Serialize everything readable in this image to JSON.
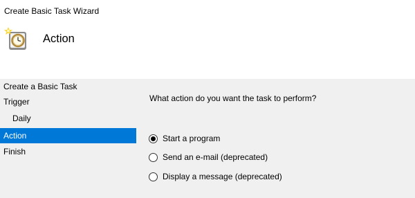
{
  "window": {
    "title": "Create Basic Task Wizard",
    "icon": "task-scheduler-clock-icon"
  },
  "header": {
    "title": "Action"
  },
  "steps": [
    {
      "label": "Create a Basic Task",
      "active": false
    },
    {
      "label": "Trigger",
      "active": false
    },
    {
      "label": "Daily",
      "active": false,
      "sub": true
    },
    {
      "label": "Action",
      "active": true
    },
    {
      "label": "Finish",
      "active": false
    }
  ],
  "content": {
    "question": "What action do you want the task to perform?",
    "options": [
      {
        "label": "Start a program",
        "checked": true
      },
      {
        "label": "Send an e-mail (deprecated)",
        "checked": false
      },
      {
        "label": "Display a message (deprecated)",
        "checked": false
      }
    ]
  },
  "colors": {
    "selection": "#0078d7",
    "header_bg": "#ffffff",
    "body_bg": "#f0f0f0"
  }
}
